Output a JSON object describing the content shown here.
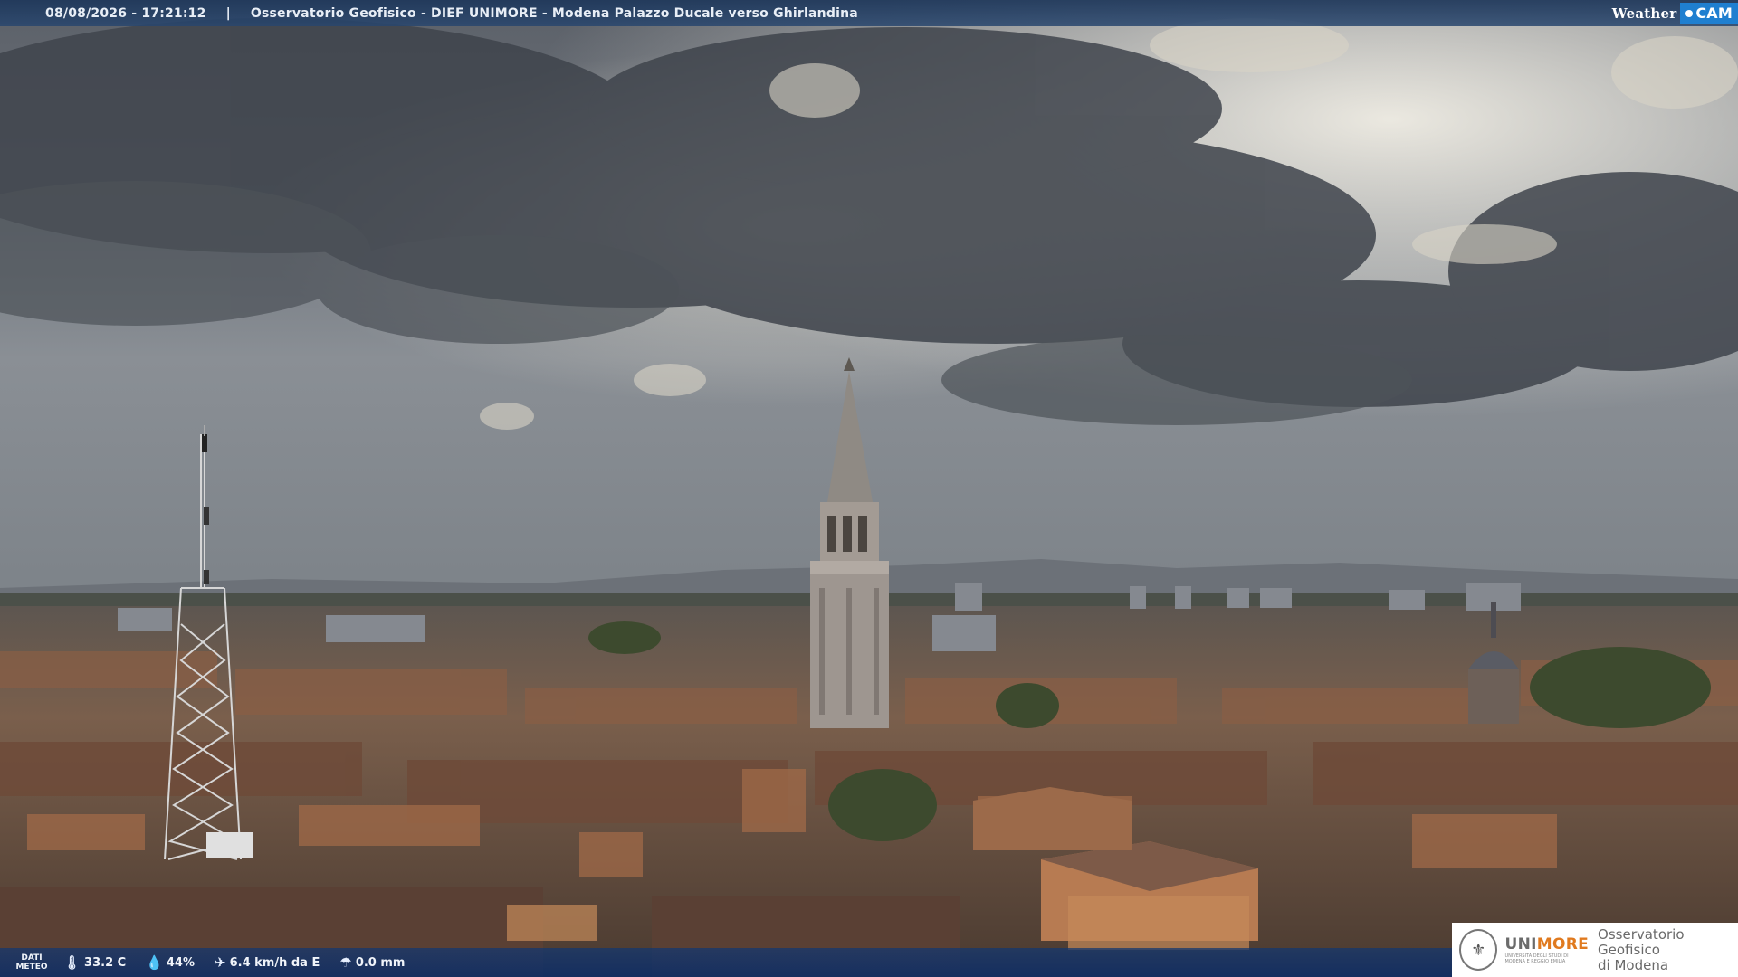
{
  "header": {
    "timestamp": "08/08/2026 - 17:21:12",
    "separator": "|",
    "camera_title": "Osservatorio Geofisico - DIEF UNIMORE - Modena Palazzo Ducale verso Ghirlandina",
    "brand_weather": "Weather",
    "brand_cam": "CAM"
  },
  "meteo": {
    "label_line1": "DATI",
    "label_line2": "METEO",
    "temperature": "33.2 C",
    "humidity": "44%",
    "wind": "6.4 km/h da E",
    "rain": "0.0 mm"
  },
  "logo": {
    "uni_part1": "UNI",
    "uni_part2": "MORE",
    "uni_sub1": "UNIVERSITÀ DEGLI STUDI DI",
    "uni_sub2": "MODENA E REGGIO EMILIA",
    "obs_line1": "Osservatorio Geofisico",
    "obs_line2": "di Modena"
  },
  "icons": {
    "thermometer": "thermometer-icon",
    "humidity": "droplet-icon",
    "wind": "wind-icon",
    "rain": "rain-icon"
  }
}
